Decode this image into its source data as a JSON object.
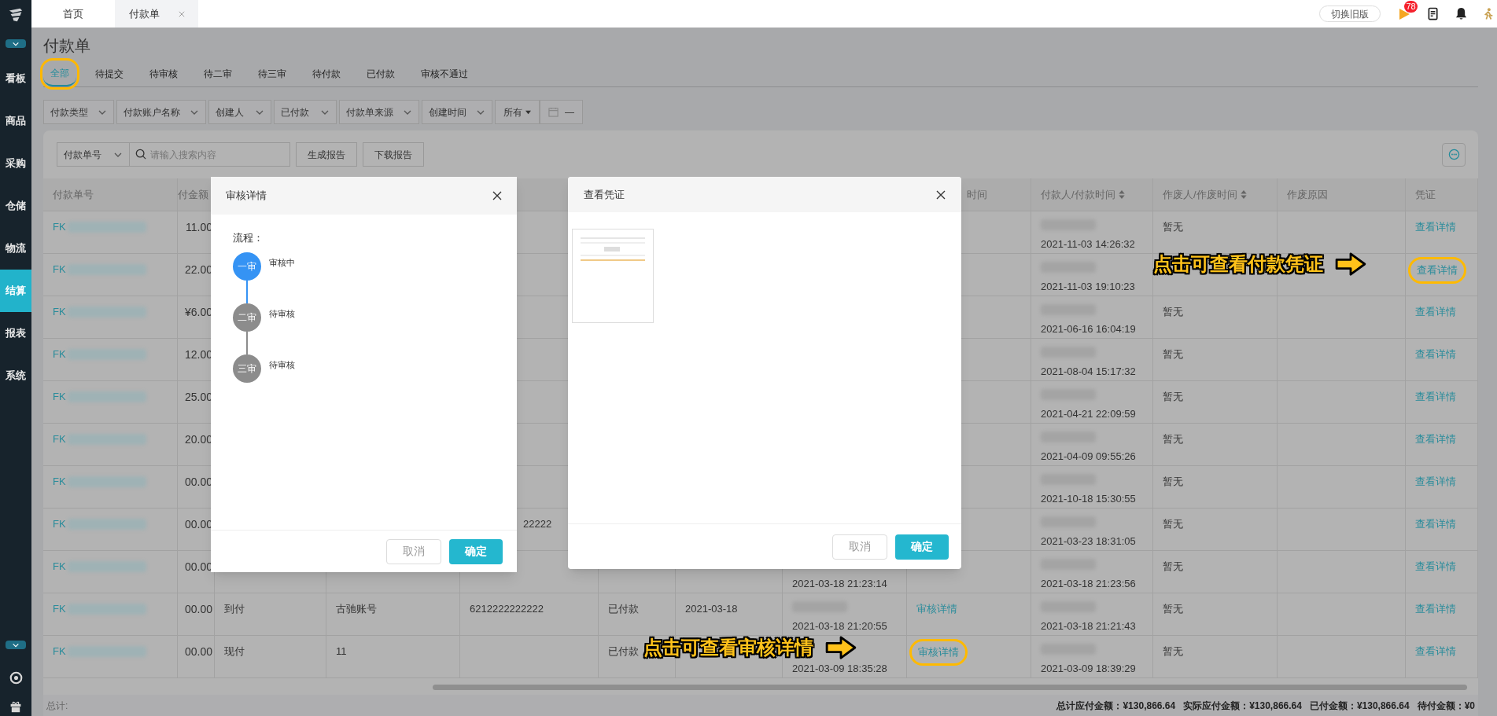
{
  "top_tabs": [
    {
      "label": "首页",
      "selected": false,
      "closable": false
    },
    {
      "label": "付款单",
      "selected": true,
      "closable": true
    }
  ],
  "top_right": {
    "switch_button": "切换旧版",
    "flag_badge": "78"
  },
  "sidebar": {
    "items": [
      {
        "label": "看板",
        "selected": false
      },
      {
        "label": "商品",
        "selected": false
      },
      {
        "label": "采购",
        "selected": false
      },
      {
        "label": "仓储",
        "selected": false
      },
      {
        "label": "物流",
        "selected": false
      },
      {
        "label": "结算",
        "selected": true
      },
      {
        "label": "报表",
        "selected": false
      },
      {
        "label": "系统",
        "selected": false
      }
    ]
  },
  "page_title": "付款单",
  "status_tabs": [
    {
      "label": "全部",
      "selected": true,
      "highlighted": true
    },
    {
      "label": "待提交",
      "selected": false,
      "highlighted": false
    },
    {
      "label": "待审核",
      "selected": false,
      "highlighted": false
    },
    {
      "label": "待二审",
      "selected": false,
      "highlighted": false
    },
    {
      "label": "待三审",
      "selected": false,
      "highlighted": false
    },
    {
      "label": "待付款",
      "selected": false,
      "highlighted": false
    },
    {
      "label": "已付款",
      "selected": false,
      "highlighted": false
    },
    {
      "label": "审核不通过",
      "selected": false,
      "highlighted": false
    }
  ],
  "filters": {
    "selects": [
      "付款类型",
      "付款账户名称",
      "创建人",
      "已付款",
      "付款单来源",
      "创建时间"
    ],
    "range_select": "所有",
    "date_separator": "—"
  },
  "search": {
    "field_select": "付款单号",
    "placeholder": "请输入搜索内容",
    "buttons": [
      "生成报告",
      "下载报告"
    ]
  },
  "table": {
    "columns": [
      {
        "label": "付款单号",
        "sortable": false
      },
      {
        "label": "付金额",
        "sortable": false
      },
      "",
      "",
      "",
      "",
      "",
      "",
      {
        "label": "时间",
        "sortable": false
      },
      {
        "label": "付款人/付款时间",
        "sortable": true
      },
      {
        "label": "作废人/作废时间",
        "sortable": true
      },
      {
        "label": "作废原因",
        "sortable": false
      },
      {
        "label": "凭证",
        "sortable": false
      }
    ],
    "rows": [
      {
        "cells": [
          {
            "kind": "id",
            "text": "FK"
          },
          {
            "kind": "amount",
            "text": "11.00"
          },
          "",
          "",
          "",
          "",
          "",
          "",
          "",
          {
            "kind": "person_time",
            "text": "2021-11-03 14:26:32"
          },
          {
            "kind": "text",
            "text": "暂无"
          },
          "",
          {
            "kind": "link",
            "text": "查看详情",
            "highlighted": false
          }
        ]
      },
      {
        "cells": [
          {
            "kind": "id",
            "text": "FK"
          },
          {
            "kind": "amount",
            "text": "22.00"
          },
          "",
          "",
          "",
          "",
          "",
          "",
          "",
          {
            "kind": "person_time",
            "text": "2021-11-03 19:10:23"
          },
          "",
          "",
          {
            "kind": "link",
            "text": "查看详情",
            "highlighted": true
          }
        ]
      },
      {
        "cells": [
          {
            "kind": "id",
            "text": "FK"
          },
          {
            "kind": "amount",
            "text": "¥6.00"
          },
          "",
          "",
          "",
          "",
          "",
          "",
          "",
          {
            "kind": "person_time",
            "text": "2021-06-16 16:04:19"
          },
          {
            "kind": "text",
            "text": "暂无"
          },
          "",
          {
            "kind": "link",
            "text": "查看详情",
            "highlighted": false
          }
        ]
      },
      {
        "cells": [
          {
            "kind": "id",
            "text": "FK"
          },
          {
            "kind": "amount",
            "text": "12.00"
          },
          "",
          "",
          "",
          "",
          "",
          "",
          "",
          {
            "kind": "person_time",
            "text": "2021-08-04 15:17:32"
          },
          {
            "kind": "text",
            "text": "暂无"
          },
          "",
          {
            "kind": "link",
            "text": "查看详情",
            "highlighted": false
          }
        ]
      },
      {
        "cells": [
          {
            "kind": "id",
            "text": "FK"
          },
          {
            "kind": "amount",
            "text": "25.00"
          },
          "",
          "",
          "",
          "",
          "",
          "",
          "",
          {
            "kind": "person_time",
            "text": "2021-04-21 22:09:59"
          },
          {
            "kind": "text",
            "text": "暂无"
          },
          "",
          {
            "kind": "link",
            "text": "查看详情",
            "highlighted": false
          }
        ]
      },
      {
        "cells": [
          {
            "kind": "id",
            "text": "FK"
          },
          {
            "kind": "amount",
            "text": "20.00"
          },
          "",
          "",
          "",
          "",
          "",
          "",
          "",
          {
            "kind": "person_time",
            "text": "2021-04-09 09:55:26"
          },
          {
            "kind": "text",
            "text": "暂无"
          },
          "",
          {
            "kind": "link",
            "text": "查看详情",
            "highlighted": false
          }
        ]
      },
      {
        "cells": [
          {
            "kind": "id",
            "text": "FK"
          },
          {
            "kind": "amount",
            "text": "00.00"
          },
          "",
          "",
          "",
          "",
          "",
          "",
          "",
          {
            "kind": "person_time",
            "text": "2021-10-18 15:30:55"
          },
          {
            "kind": "text",
            "text": "暂无"
          },
          "",
          {
            "kind": "link",
            "text": "查看详情",
            "highlighted": false
          }
        ]
      },
      {
        "cells": [
          {
            "kind": "id",
            "text": "FK"
          },
          {
            "kind": "amount",
            "text": "00.00"
          },
          "",
          "",
          {
            "kind": "partial",
            "text": "22222"
          },
          "",
          "",
          "",
          "",
          {
            "kind": "person_time",
            "text": "2021-03-23 18:31:05"
          },
          {
            "kind": "text",
            "text": "暂无"
          },
          "",
          {
            "kind": "link",
            "text": "查看详情",
            "highlighted": false
          }
        ]
      },
      {
        "cells": [
          {
            "kind": "id",
            "text": "FK"
          },
          {
            "kind": "amount",
            "text": "00.00"
          },
          "",
          "",
          "",
          "",
          "",
          {
            "kind": "time",
            "text": "2021-03-18 21:23:14"
          },
          "",
          {
            "kind": "person_time",
            "text": "2021-03-18 21:23:56"
          },
          {
            "kind": "text",
            "text": "暂无"
          },
          "",
          {
            "kind": "link",
            "text": "查看详情",
            "highlighted": false
          }
        ]
      },
      {
        "cells": [
          {
            "kind": "id",
            "text": "FK"
          },
          {
            "kind": "amount",
            "text": "00.00"
          },
          {
            "kind": "text",
            "text": "到付"
          },
          {
            "kind": "text",
            "text": "古驰账号"
          },
          {
            "kind": "text",
            "text": "6212222222222"
          },
          {
            "kind": "text",
            "text": "已付款"
          },
          {
            "kind": "text",
            "text": "2021-03-18"
          },
          {
            "kind": "person_time",
            "text": "2021-03-18 21:20:55"
          },
          {
            "kind": "link",
            "text": "审核详情",
            "highlighted": false
          },
          {
            "kind": "person_time",
            "text": "2021-03-18 21:21:43"
          },
          {
            "kind": "text",
            "text": "暂无"
          },
          "",
          {
            "kind": "link",
            "text": "查看详情",
            "highlighted": false
          }
        ]
      },
      {
        "cells": [
          {
            "kind": "id",
            "text": "FK"
          },
          {
            "kind": "amount",
            "text": "00.00"
          },
          {
            "kind": "text",
            "text": "现付"
          },
          {
            "kind": "text",
            "text": "11"
          },
          "",
          {
            "kind": "text",
            "text": "已付款"
          },
          "",
          {
            "kind": "time",
            "text": "2021-03-09 18:35:28"
          },
          {
            "kind": "link",
            "text": "审核详情",
            "highlighted": true
          },
          {
            "kind": "person_time",
            "text": "2021-03-09 18:39:29"
          },
          {
            "kind": "text",
            "text": "暂无"
          },
          "",
          {
            "kind": "link",
            "text": "查看详情",
            "highlighted": false
          }
        ]
      }
    ]
  },
  "footer": {
    "label": "总计:",
    "totals": [
      "总计应付金额：¥130,866.64",
      "实际应付金额：¥130,866.64",
      "已付金额：¥130,866.64",
      "待付金额：¥0"
    ]
  },
  "review_dialog": {
    "title": "审核详情",
    "flow_label": "流程：",
    "steps": [
      {
        "badge": "一审",
        "status": "审核中",
        "active": true
      },
      {
        "badge": "二审",
        "status": "待审核",
        "active": false
      },
      {
        "badge": "三审",
        "status": "待审核",
        "active": false
      }
    ],
    "buttons": [
      {
        "label": "取消",
        "primary": false
      },
      {
        "label": "确定",
        "primary": true
      }
    ]
  },
  "voucher_dialog": {
    "title": "查看凭证",
    "buttons": [
      {
        "label": "取消",
        "primary": false
      },
      {
        "label": "确定",
        "primary": true
      }
    ]
  },
  "callouts": [
    {
      "text": "点击可查看付款凭证"
    },
    {
      "text": "点击可查看审核详情"
    }
  ]
}
